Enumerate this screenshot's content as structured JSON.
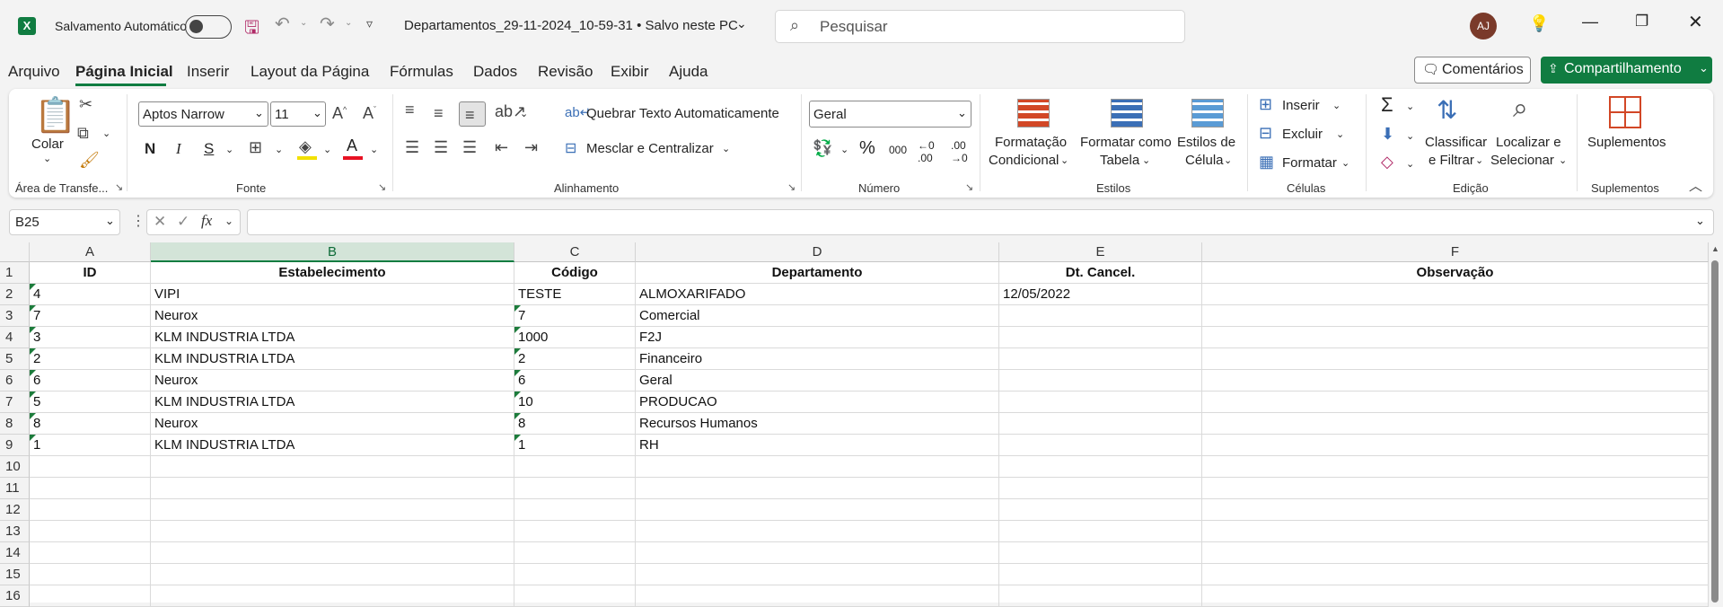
{
  "titlebar": {
    "autosave_label": "Salvamento Automático",
    "filename": "Departamentos_29-11-2024_10-59-31 • Salvo neste PC",
    "search_placeholder": "Pesquisar",
    "avatar_initials": "AJ"
  },
  "menu": {
    "items": [
      "Arquivo",
      "Página Inicial",
      "Inserir",
      "Layout da Página",
      "Fórmulas",
      "Dados",
      "Revisão",
      "Exibir",
      "Ajuda"
    ],
    "active": "Página Inicial",
    "comments_label": "Comentários",
    "share_label": "Compartilhamento"
  },
  "ribbon": {
    "clipboard": {
      "paste_label": "Colar",
      "group_label": "Área de Transfe..."
    },
    "font": {
      "name": "Aptos Narrow",
      "size": "11",
      "bold": "N",
      "italic": "I",
      "underline": "S",
      "group_label": "Fonte"
    },
    "alignment": {
      "wrap_label": "Quebrar Texto Automaticamente",
      "merge_label": "Mesclar e Centralizar",
      "group_label": "Alinhamento"
    },
    "number": {
      "format": "Geral",
      "group_label": "Número"
    },
    "styles": {
      "conditional_line1": "Formatação",
      "conditional_line2": "Condicional",
      "table_line1": "Formatar como",
      "table_line2": "Tabela",
      "cell_line1": "Estilos de",
      "cell_line2": "Célula",
      "group_label": "Estilos"
    },
    "cells": {
      "insert_label": "Inserir",
      "delete_label": "Excluir",
      "format_label": "Formatar",
      "group_label": "Células"
    },
    "editing": {
      "sort_line1": "Classificar",
      "sort_line2": "e Filtrar",
      "find_line1": "Localizar e",
      "find_line2": "Selecionar",
      "group_label": "Edição"
    },
    "addins": {
      "label": "Suplementos",
      "group_label": "Suplementos"
    }
  },
  "formula_bar": {
    "name_box": "B25",
    "fx_label": "fx",
    "content": ""
  },
  "sheet": {
    "columns": [
      "A",
      "B",
      "C",
      "D",
      "E",
      "F"
    ],
    "selected_column": "B",
    "row_numbers": [
      "1",
      "2",
      "3",
      "4",
      "5",
      "6",
      "7",
      "8",
      "9",
      "10",
      "11",
      "12",
      "13",
      "14",
      "15",
      "16"
    ],
    "header_row": [
      "ID",
      "Estabelecimento",
      "Código",
      "Departamento",
      "Dt. Cancel.",
      "Observação"
    ],
    "rows": [
      [
        "4",
        "VIPI",
        "TESTE",
        "ALMOXARIFADO",
        "12/05/2022",
        ""
      ],
      [
        "7",
        "Neurox",
        "7",
        "Comercial",
        "",
        ""
      ],
      [
        "3",
        "KLM INDUSTRIA LTDA",
        "1000",
        "F2J",
        "",
        ""
      ],
      [
        "2",
        "KLM INDUSTRIA LTDA",
        "2",
        "Financeiro",
        "",
        ""
      ],
      [
        "6",
        "Neurox",
        "6",
        "Geral",
        "",
        ""
      ],
      [
        "5",
        "KLM INDUSTRIA LTDA",
        "10",
        "PRODUCAO",
        "",
        ""
      ],
      [
        "8",
        "Neurox",
        "8",
        "Recursos Humanos",
        "",
        ""
      ],
      [
        "1",
        "KLM INDUSTRIA LTDA",
        "1",
        "RH",
        "",
        ""
      ]
    ]
  },
  "colors": {
    "accent": "#107c41",
    "selected_header": "#d3e4d8"
  }
}
